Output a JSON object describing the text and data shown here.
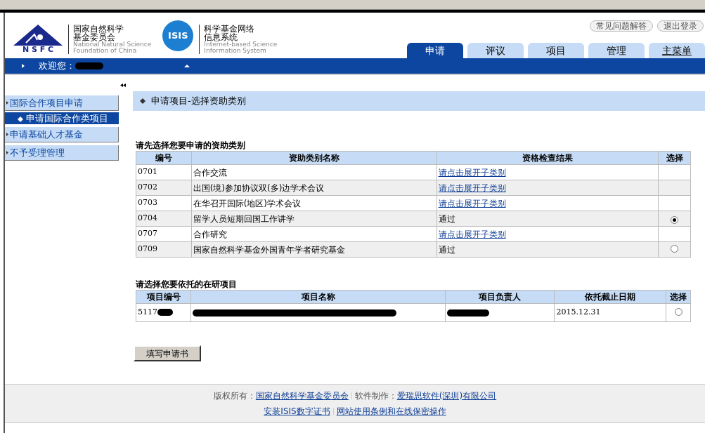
{
  "header": {
    "nsfc_logo": {
      "letters": "N S F C",
      "name_cn_1": "国家自然科学",
      "name_cn_2": "基金委员会",
      "name_en_1": "National Natural Science",
      "name_en_2": "Foundation of China"
    },
    "isis_logo": {
      "badge": "ISIS",
      "name_cn_1": "科学基金网络",
      "name_cn_2": "信息系统",
      "name_en_1": "Internet-based Science",
      "name_en_2": "Information System"
    },
    "top_buttons": [
      "常见问题解答",
      "退出登录"
    ],
    "tabs": [
      {
        "label": "申请",
        "selected": true
      },
      {
        "label": "评议",
        "selected": false
      },
      {
        "label": "项目",
        "selected": false
      },
      {
        "label": "管理",
        "selected": false
      },
      {
        "label": "主菜单",
        "selected": false,
        "underlined": true
      }
    ],
    "welcome": "欢迎您："
  },
  "sidebar": {
    "items": [
      {
        "label": "国际合作项目申请",
        "kind": "group",
        "selected": false
      },
      {
        "label": "申请国际合作类项目",
        "kind": "subitem",
        "selected": true
      },
      {
        "label": "申请基础人才基金",
        "kind": "group",
        "selected": false
      },
      {
        "label": "不予受理管理",
        "kind": "group",
        "selected": false
      }
    ]
  },
  "page_title": "申请项目-选择资助类别",
  "category_table": {
    "heading": "请先选择您要申请的资助类别",
    "columns": [
      "编号",
      "资助类别名称",
      "资格检查结果",
      "选择"
    ],
    "rows": [
      {
        "code": "0701",
        "name": "合作交流",
        "result": "请点击展开子类别",
        "kind": "link"
      },
      {
        "code": "0702",
        "name": "出国(境)参加协议双(多)边学术会议",
        "result": "请点击展开子类别",
        "kind": "link"
      },
      {
        "code": "0703",
        "name": "在华召开国际(地区)学术会议",
        "result": "请点击展开子类别",
        "kind": "link"
      },
      {
        "code": "0704",
        "name": "留学人员短期回国工作讲学",
        "result": "通过",
        "kind": "text",
        "selected": true
      },
      {
        "code": "0707",
        "name": "合作研究",
        "result": "请点击展开子类别",
        "kind": "link"
      },
      {
        "code": "0709",
        "name": "国家自然科学基金外国青年学者研究基金",
        "result": "通过",
        "kind": "text",
        "selected": false
      }
    ]
  },
  "project_table": {
    "heading": "请选择您要依托的在研项目",
    "columns": [
      "项目编号",
      "项目名称",
      "项目负责人",
      "依托截止日期",
      "选择"
    ],
    "rows": [
      {
        "number": "5117",
        "deadline": "2015.12.31",
        "selected": false
      }
    ]
  },
  "submit_button": "填写申请书",
  "footer": {
    "copyright_label": "版权所有：",
    "copyright_link": "国家自然科学基金委员会",
    "software_label": "软件制作：",
    "software_link": "爱瑞思软件(深圳)有限公司",
    "links": [
      "安装ISIS数字证书",
      "网站使用条例和在线保密操作"
    ]
  }
}
